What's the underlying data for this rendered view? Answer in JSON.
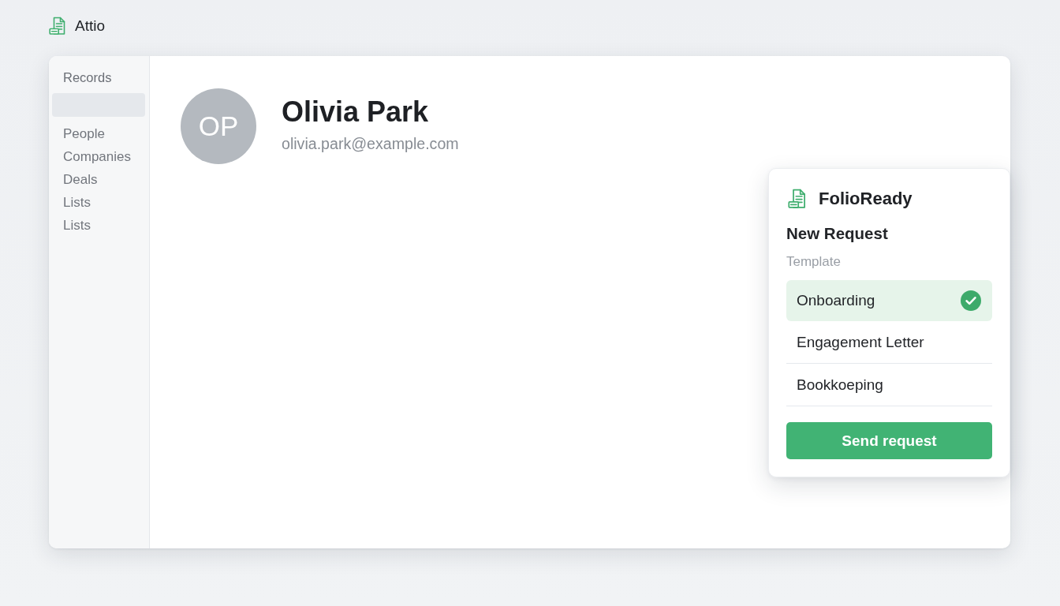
{
  "app": {
    "name": "Attio"
  },
  "sidebar": {
    "heading": "Records",
    "items": [
      {
        "selected": true
      },
      {
        "label": "People",
        "selected": false
      },
      {
        "label": "Companies",
        "selected": false
      },
      {
        "label": "Deals",
        "selected": false
      },
      {
        "label": "Lists",
        "selected": false
      },
      {
        "label": "Lists",
        "selected": false
      }
    ]
  },
  "record": {
    "initials": "OP",
    "name": "Olivia Park",
    "email": "olivia.park@example.com"
  },
  "panel": {
    "title": "FolioReady",
    "subtitle": "New Request",
    "field_label": "Template",
    "options": [
      {
        "label": "Onboarding",
        "selected": true
      },
      {
        "label": "Engagement Letter",
        "selected": false
      },
      {
        "label": "Bookkoeping",
        "selected": false
      }
    ],
    "button": "Send request"
  }
}
